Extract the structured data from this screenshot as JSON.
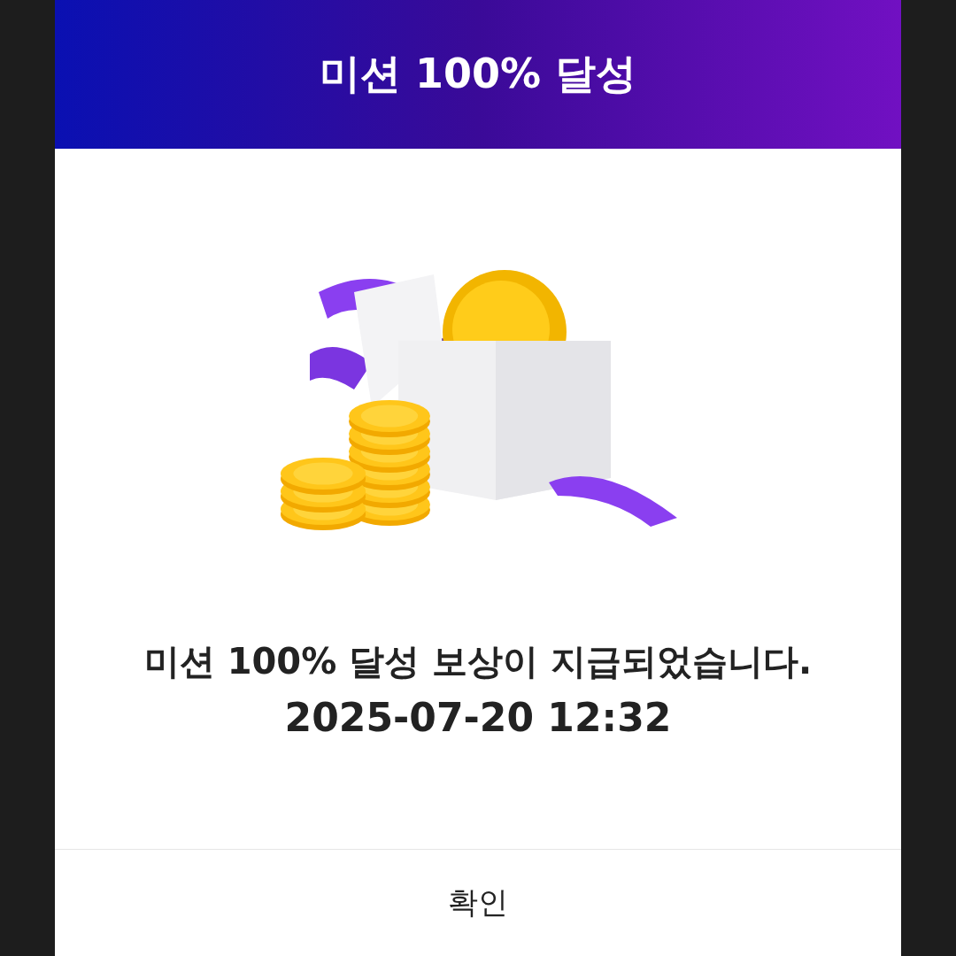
{
  "dialog": {
    "title": "미션 100% 달성",
    "message": "미션 100% 달성 보상이 지급되었습니다.",
    "timestamp": "2025-07-20 12:32",
    "buttons": [
      "확인"
    ]
  }
}
